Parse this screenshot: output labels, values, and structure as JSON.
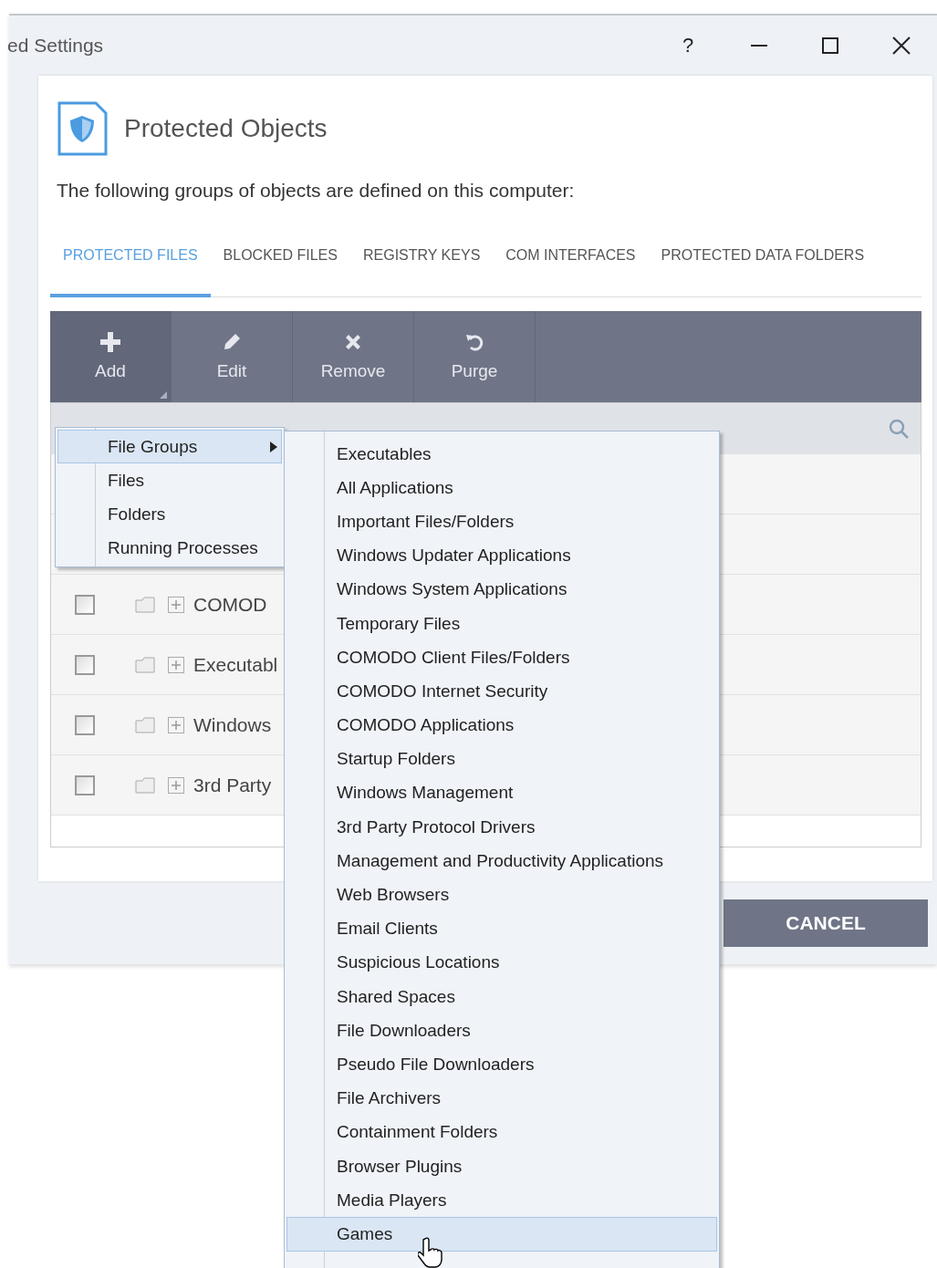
{
  "window": {
    "title": "ed Settings",
    "help": "?"
  },
  "header": {
    "title": "Protected Objects",
    "description": "The following groups of objects are defined on this computer:"
  },
  "tabs": [
    {
      "label": "PROTECTED FILES",
      "selected": true
    },
    {
      "label": "BLOCKED FILES",
      "selected": false
    },
    {
      "label": "REGISTRY KEYS",
      "selected": false
    },
    {
      "label": "COM INTERFACES",
      "selected": false
    },
    {
      "label": "PROTECTED DATA FOLDERS",
      "selected": false
    }
  ],
  "toolbar": [
    {
      "kind": "add",
      "label": "Add",
      "active": true
    },
    {
      "kind": "edit",
      "label": "Edit",
      "active": false
    },
    {
      "kind": "remove",
      "label": "Remove",
      "active": false
    },
    {
      "kind": "purge",
      "label": "Purge",
      "active": false
    }
  ],
  "table": {
    "rows": [
      {
        "name": "COMOD",
        "checked": false,
        "expanded": false
      },
      {
        "name": "Executabl",
        "checked": false,
        "expanded": false
      },
      {
        "name": "Windows",
        "checked": false,
        "expanded": false
      },
      {
        "name": "3rd Party",
        "checked": false,
        "expanded": false
      }
    ]
  },
  "footer": {
    "cancel": "CANCEL"
  },
  "add_menu": [
    {
      "label": "File Groups",
      "selected": true,
      "submenu": true
    },
    {
      "label": "Files",
      "selected": false,
      "submenu": false
    },
    {
      "label": "Folders",
      "selected": false,
      "submenu": false
    },
    {
      "label": "Running Processes",
      "selected": false,
      "submenu": false
    }
  ],
  "file_groups_menu": [
    {
      "label": "Executables",
      "selected": false
    },
    {
      "label": "All Applications",
      "selected": false
    },
    {
      "label": "Important Files/Folders",
      "selected": false
    },
    {
      "label": "Windows Updater Applications",
      "selected": false
    },
    {
      "label": "Windows System Applications",
      "selected": false
    },
    {
      "label": "Temporary Files",
      "selected": false
    },
    {
      "label": "COMODO Client Files/Folders",
      "selected": false
    },
    {
      "label": "COMODO Internet Security",
      "selected": false
    },
    {
      "label": "COMODO Applications",
      "selected": false
    },
    {
      "label": "Startup Folders",
      "selected": false
    },
    {
      "label": "Windows Management",
      "selected": false
    },
    {
      "label": "3rd Party Protocol Drivers",
      "selected": false
    },
    {
      "label": "Management and Productivity Applications",
      "selected": false
    },
    {
      "label": "Web Browsers",
      "selected": false
    },
    {
      "label": "Email Clients",
      "selected": false
    },
    {
      "label": "Suspicious Locations",
      "selected": false
    },
    {
      "label": "Shared Spaces",
      "selected": false
    },
    {
      "label": "File Downloaders",
      "selected": false
    },
    {
      "label": "Pseudo File Downloaders",
      "selected": false
    },
    {
      "label": "File Archivers",
      "selected": false
    },
    {
      "label": "Containment Folders",
      "selected": false
    },
    {
      "label": "Browser Plugins",
      "selected": false
    },
    {
      "label": "Media Players",
      "selected": false
    },
    {
      "label": "Games",
      "selected": true
    }
  ]
}
